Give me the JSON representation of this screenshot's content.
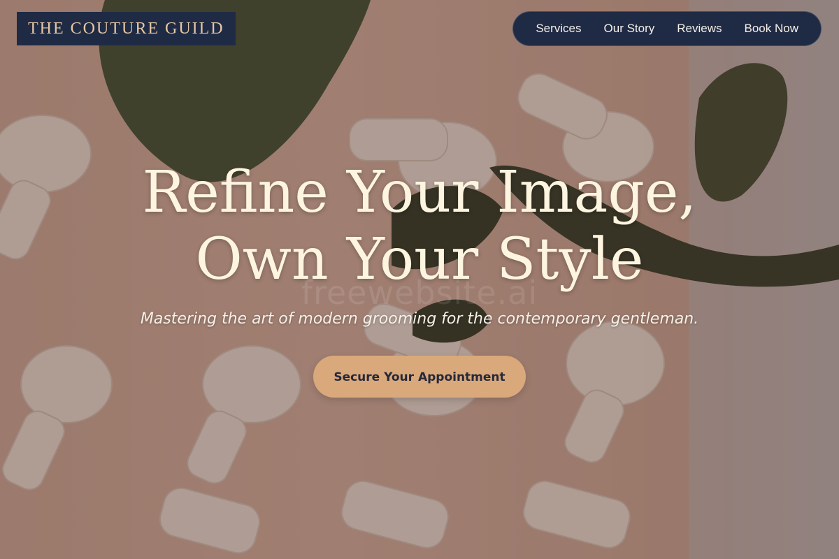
{
  "brand": {
    "name": "THE COUTURE GUILD"
  },
  "nav": {
    "items": [
      {
        "label": "Services"
      },
      {
        "label": "Our Story"
      },
      {
        "label": "Reviews"
      },
      {
        "label": "Book Now"
      }
    ]
  },
  "hero": {
    "title_line_1": "Refine Your Image,",
    "title_line_2": "Own Your Style",
    "subtitle": "Mastering the art of modern grooming for the contemporary gentleman.",
    "cta_label": "Secure Your Appointment",
    "watermark": "freewebsite.ai"
  },
  "colors": {
    "navy": "#1f2b44",
    "accent_gold": "#e6c6a3",
    "cta_tan": "#d9a97c",
    "title_cream": "#fdf5df"
  }
}
